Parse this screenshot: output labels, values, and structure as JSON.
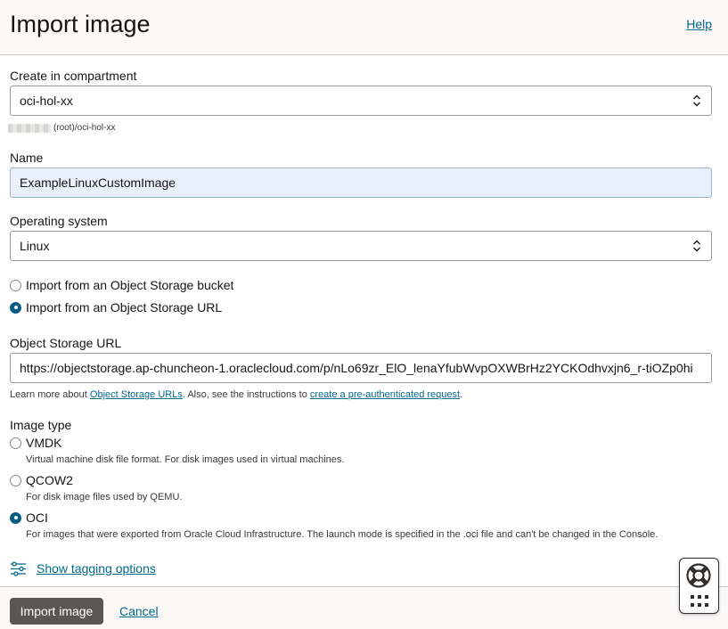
{
  "header": {
    "title": "Import image",
    "help_label": "Help"
  },
  "compartment": {
    "label": "Create in compartment",
    "value": "oci-hol-xx",
    "path_suffix": "(root)/oci-hol-xx"
  },
  "name": {
    "label": "Name",
    "value": "ExampleLinuxCustomImage"
  },
  "os": {
    "label": "Operating system",
    "value": "Linux"
  },
  "source": {
    "options": [
      {
        "label": "Import from an Object Storage bucket",
        "checked": false
      },
      {
        "label": "Import from an Object Storage URL",
        "checked": true
      }
    ]
  },
  "url": {
    "label": "Object Storage URL",
    "value": "https://objectstorage.ap-chuncheon-1.oraclecloud.com/p/nLo69zr_ElO_lenaYfubWvpOXWBrHz2YCKOdhvxjn6_r-tiOZp0hi",
    "hint_prefix": "Learn more about ",
    "hint_link1": "Object Storage URLs",
    "hint_middle": ". Also, see the instructions to ",
    "hint_link2": "create a pre-authenticated request",
    "hint_suffix": "."
  },
  "image_type": {
    "label": "Image type",
    "options": [
      {
        "label": "VMDK",
        "desc": "Virtual machine disk file format. For disk images used in virtual machines.",
        "checked": false
      },
      {
        "label": "QCOW2",
        "desc": "For disk image files used by QEMU.",
        "checked": false
      },
      {
        "label": "OCI",
        "desc": "For images that were exported from Oracle Cloud Infrastructure. The launch mode is specified in the .oci file and can't be changed in the Console.",
        "checked": true
      }
    ]
  },
  "tagging": {
    "label": "Show tagging options",
    "icon": "sliders-icon"
  },
  "footer": {
    "primary_label": "Import image",
    "cancel_label": "Cancel"
  },
  "help_widget": {
    "icons": [
      "lifebuoy-icon",
      "grid-dots-icon"
    ]
  },
  "colors": {
    "link": "#00688c",
    "primary_button": "#5b5652",
    "radio_checked": "#0a5d82"
  }
}
